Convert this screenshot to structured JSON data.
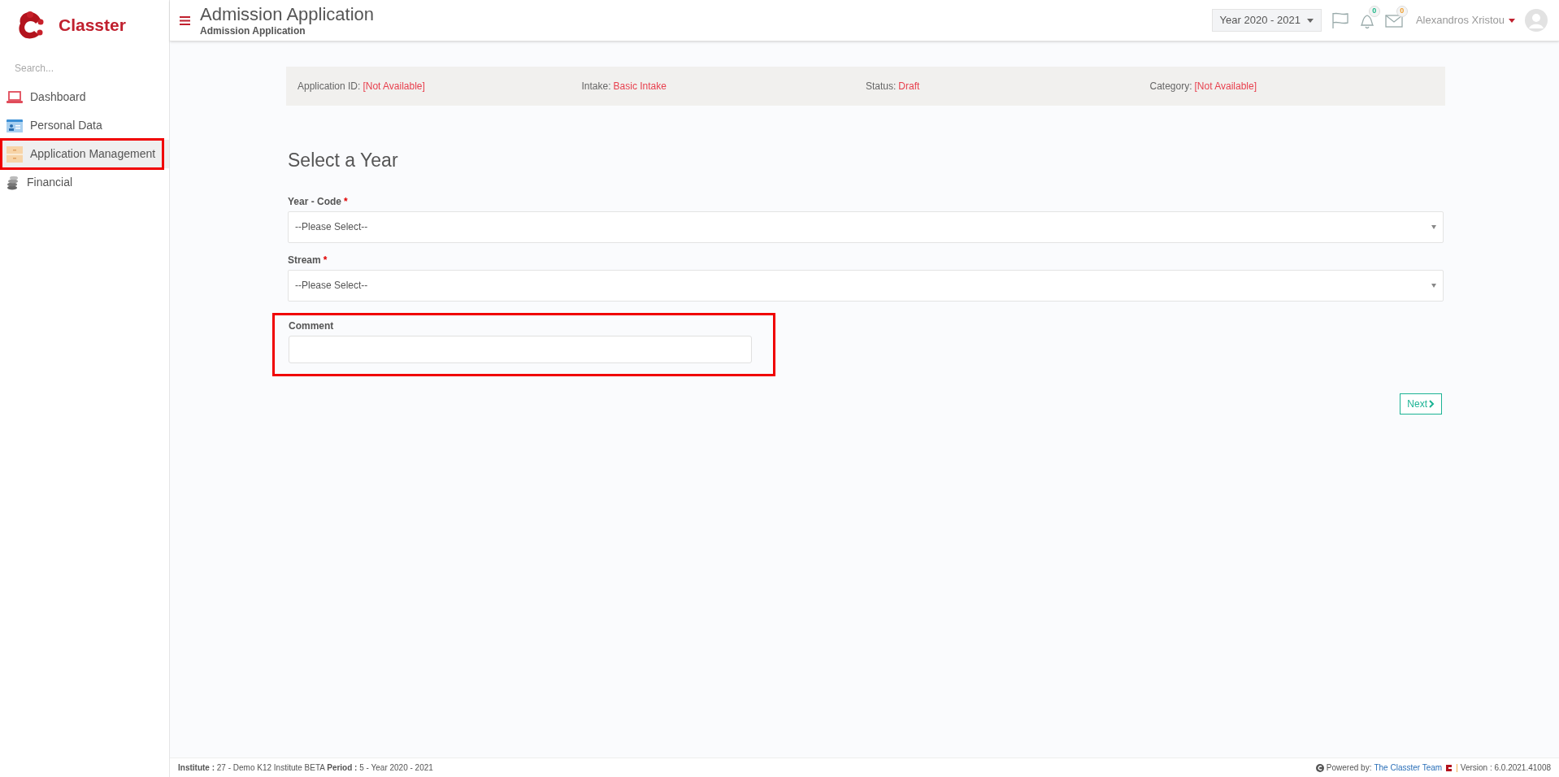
{
  "logo": {
    "text": "Classter"
  },
  "sidebar": {
    "search": {
      "placeholder": "Search..."
    },
    "items": [
      {
        "label": "Dashboard",
        "kind": "laptop",
        "selected": false,
        "highlighted": false
      },
      {
        "label": "Personal Data",
        "kind": "idcard",
        "selected": false,
        "highlighted": false
      },
      {
        "label": "Application Management",
        "kind": "folder",
        "selected": true,
        "highlighted": true
      },
      {
        "label": "Financial",
        "kind": "coins",
        "selected": false,
        "highlighted": false
      }
    ]
  },
  "header": {
    "title": "Admission Application",
    "subtitle": "Admission Application",
    "year": "Year 2020 - 2021",
    "notifications": "0",
    "messages": "0",
    "user": "Alexandros Xristou"
  },
  "info_bar": [
    {
      "label": "Application ID:",
      "value": "[Not Available]"
    },
    {
      "label": "Intake:",
      "value": "Basic Intake"
    },
    {
      "label": "Status:",
      "value": "Draft"
    },
    {
      "label": "Category:",
      "value": "[Not Available]"
    }
  ],
  "form": {
    "title": "Select a Year",
    "fields": [
      {
        "label": "Year - Code",
        "required_mark": "*",
        "kind": "select",
        "value": "--Please Select--",
        "highlighted": false
      },
      {
        "label": "Stream",
        "required_mark": "*",
        "kind": "select",
        "value": "--Please Select--",
        "highlighted": false
      },
      {
        "label": "Comment",
        "kind": "text",
        "highlighted": true
      }
    ],
    "next": "Next"
  },
  "footer": {
    "institute_label": "Institute :",
    "institute": "27 - Demo K12 Institute BETA",
    "period_label": "Period :",
    "period": "5 - Year 2020 - 2021",
    "powered": "Powered by:",
    "team": "The Classter Team",
    "separator": "|",
    "version": "Version : 6.0.2021.41008"
  }
}
